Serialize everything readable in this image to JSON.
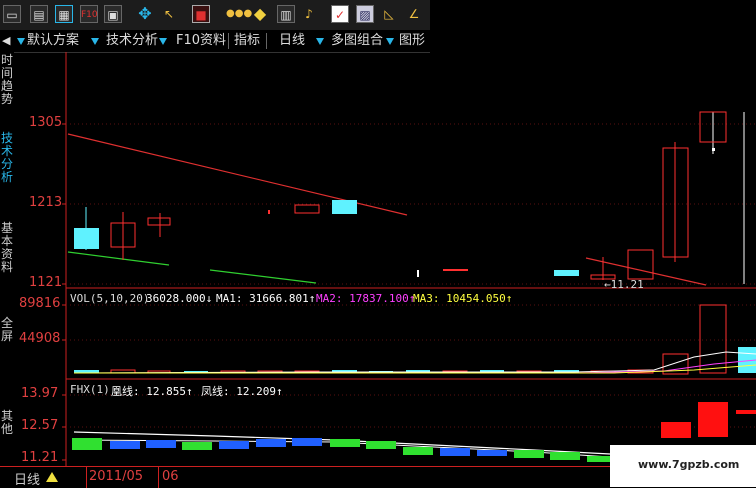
{
  "toolbar": {
    "icons": [
      "folder-icon",
      "chart-icon",
      "grid-icon",
      "news-icon",
      "info-icon",
      "move-icon",
      "cursor-icon",
      "stop-icon",
      "traffic-light-icon",
      "warning-icon",
      "calculator-icon",
      "bell-icon",
      "check-icon",
      "image-icon",
      "draw-icon",
      "angle-icon"
    ]
  },
  "menu": {
    "items": [
      "默认方案",
      "技术分析",
      "F10资料",
      "指标",
      "日线",
      "多图组合",
      "图形"
    ]
  },
  "left_tabs": [
    "时间趋势",
    "技术分析",
    "基本资料",
    "全屏",
    "其他"
  ],
  "price_axis": {
    "labels": [
      "1305",
      "1213",
      "1121"
    ]
  },
  "vol_axis": {
    "labels": [
      "89816",
      "44908"
    ]
  },
  "fhx_axis": {
    "labels": [
      "13.97",
      "12.57",
      "11.21"
    ]
  },
  "annotation": {
    "text": "←11.21"
  },
  "vol_legend": {
    "name": "VOL(5,10,20)",
    "vol": "36028.000↓",
    "ma1": "MA1: 31666.801↑",
    "ma2": "MA2: 17837.100↑",
    "ma3": "MA3: 10454.050↑"
  },
  "fhx_legend": {
    "name": "FHX(1)",
    "huang": "凰线: 12.855↑",
    "feng": "凤线: 12.209↑"
  },
  "bottom": {
    "period": "日线",
    "date": "2011/05",
    "date2": "06"
  },
  "watermark": {
    "text": "www.7gpzb.com"
  },
  "colors": {
    "up": "#ff3030",
    "down": "#5ff2ff",
    "ma1": "#ffffff",
    "ma2": "#ff40ff",
    "ma3": "#ffff40",
    "axis": "#cc2020"
  }
}
